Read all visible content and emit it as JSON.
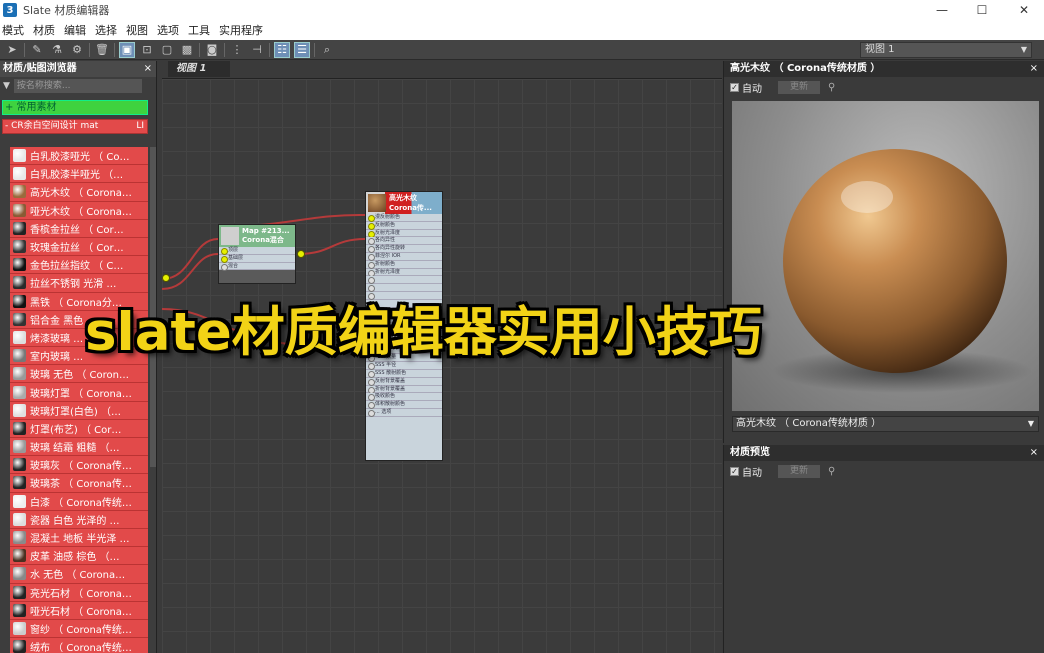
{
  "window": {
    "title": "Slate 材质编辑器",
    "icon": "3ds-max-icon",
    "controls": [
      "minimize",
      "maximize",
      "close"
    ]
  },
  "menu": [
    "模式",
    "材质",
    "编辑",
    "选择",
    "视图",
    "选项",
    "工具",
    "实用程序"
  ],
  "toolbar": {
    "view_selector": "视图 1"
  },
  "browser": {
    "title": "材质/贴图浏览器",
    "search_placeholder": "按名称搜索...",
    "common_group": "+ 常用素材",
    "group_label": "- CR余白空间设计 mat",
    "group_count": "LI",
    "items": [
      {
        "label": "白乳胶漆哑光  （ Co…",
        "swatch": "#e8e8e8"
      },
      {
        "label": "白乳胶漆半哑光  （…",
        "swatch": "#e8e8e8"
      },
      {
        "label": "高光木纹  （ Corona…",
        "swatch": "#9a6a3c"
      },
      {
        "label": "哑光木纹  （ Corona…",
        "swatch": "#8a5a34"
      },
      {
        "label": "香槟金拉丝  （ Cor…",
        "swatch": "#222222"
      },
      {
        "label": "玫瑰金拉丝  （ Cor…",
        "swatch": "#333333"
      },
      {
        "label": "金色拉丝指纹  （ C…",
        "swatch": "#111111"
      },
      {
        "label": "拉丝不锈钢 光滑 …",
        "swatch": "#2a2a2a"
      },
      {
        "label": "黑铁  （ Corona分…",
        "swatch": "#111111"
      },
      {
        "label": "铝合金 黑色 …",
        "swatch": "#333333"
      },
      {
        "label": "烤漆玻璃 …",
        "swatch": "#dddddd"
      },
      {
        "label": "室内玻璃 …",
        "swatch": "#777777"
      },
      {
        "label": "玻璃 无色  （ Coron…",
        "swatch": "#999999"
      },
      {
        "label": "玻璃灯罩  （ Corona…",
        "swatch": "#aaaaaa"
      },
      {
        "label": "玻璃灯罩(白色)  （…",
        "swatch": "#e0e0e0"
      },
      {
        "label": "灯罩(布艺)  （ Cor…",
        "swatch": "#222222"
      },
      {
        "label": "玻璃 结霜 粗糙  （…",
        "swatch": "#999999"
      },
      {
        "label": "玻璃灰  （ Corona传…",
        "swatch": "#222222"
      },
      {
        "label": "玻璃茶  （ Corona传…",
        "swatch": "#222222"
      },
      {
        "label": "白漆  （ Corona传统…",
        "swatch": "#eeeeee"
      },
      {
        "label": "瓷器 白色 光泽的 …",
        "swatch": "#dddddd"
      },
      {
        "label": "混凝土 地板 半光泽 …",
        "swatch": "#8a8a8a"
      },
      {
        "label": "皮革 油感 棕色  （…",
        "swatch": "#4a3020"
      },
      {
        "label": "水 无色  （ Corona…",
        "swatch": "#888888"
      },
      {
        "label": "亮光石材  （ Corona…",
        "swatch": "#222222"
      },
      {
        "label": "哑光石材  （ Corona…",
        "swatch": "#222222"
      },
      {
        "label": "窗纱  （ Corona传统…",
        "swatch": "#cccccc"
      },
      {
        "label": "绒布  （ Corona传统…",
        "swatch": "#222222"
      }
    ]
  },
  "view_tab": "视图 1",
  "nodes": {
    "map": {
      "title": "Map #213...",
      "subtitle": "Corona混合",
      "slots": [
        "顶层",
        "基础层",
        "混合"
      ]
    },
    "material": {
      "title": "高光木纹",
      "subtitle": "Corona传...",
      "slots": [
        "漫反射颜色",
        "反射颜色",
        "反射光泽度",
        "各向异性",
        "各向异性旋转",
        "菲涅尔 IOR",
        "折射颜色",
        "折射光泽度",
        "",
        "",
        "",
        "",
        "",
        "",
        "",
        "",
        "",
        "",
        "SSS 数量",
        "SSS 半径",
        "SSS 散射颜色",
        "反射背景覆盖",
        "折射背景覆盖",
        "吸收颜色",
        "体积散射颜色",
        "... 选项"
      ]
    }
  },
  "preview_panel": {
    "title": "高光木纹 （ Corona传统材质 ）",
    "auto_label": "自动",
    "update_label": "更新",
    "material_select": "高光木纹  （ Corona传统材质 ）"
  },
  "material_preview_panel": {
    "title": "材质预览",
    "auto_label": "自动",
    "update_label": "更新"
  },
  "overlay_headline": "slate材质编辑器实用小技巧"
}
